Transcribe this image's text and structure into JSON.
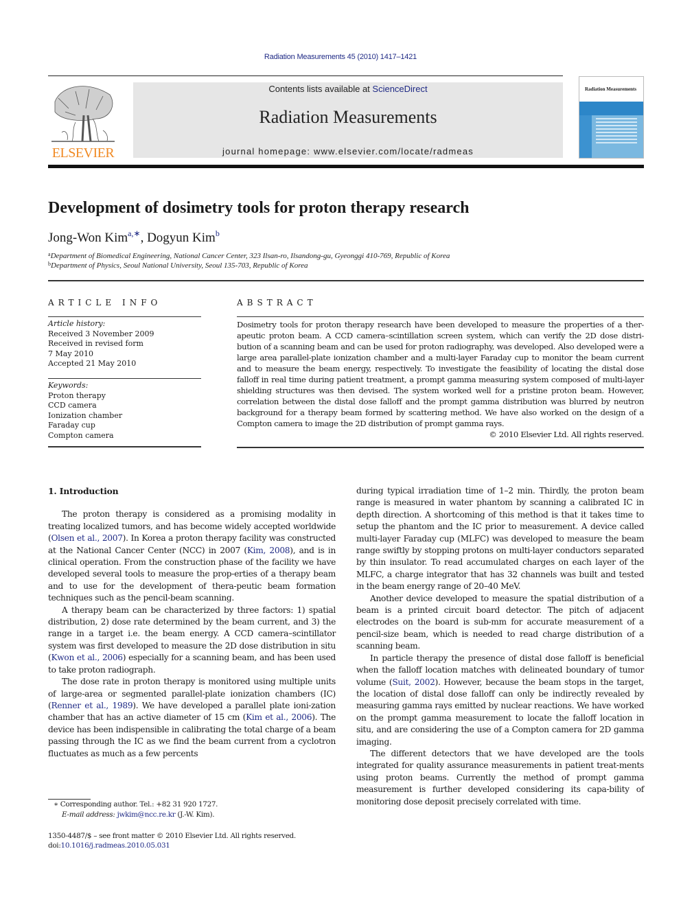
{
  "header": {
    "citation": "Radiation Measurements 45 (2010) 1417–1421",
    "contents_prefix": "Contents lists available at ",
    "contents_link": "ScienceDirect",
    "journal_name": "Radiation Measurements",
    "homepage_prefix": "journal homepage: ",
    "homepage_url": "www.elsevier.com/locate/radmeas",
    "publisher_logo_text": "ELSEVIER",
    "cover_title": "Radiation Measurements"
  },
  "colors": {
    "link": "#1f2a85",
    "elsevier_orange": "#f08a24",
    "banner_gray": "#e6e6e6",
    "cover_blue": "#7ab8e0"
  },
  "article": {
    "title": "Development of dosimetry tools for proton therapy research",
    "authors": [
      {
        "name": "Jong-Won Kim",
        "marks": "a,∗"
      },
      {
        "name": "Dogyun Kim",
        "marks": "b"
      }
    ],
    "author_separator": ", ",
    "affiliations": [
      {
        "mark": "a",
        "text": "Department of Biomedical Engineering, National Cancer Center, 323 Ilsan-ro, Ilsandong-gu, Gyeonggi 410-769, Republic of Korea"
      },
      {
        "mark": "b",
        "text": "Department of Physics, Seoul National University, Seoul 135-703, Republic of Korea"
      }
    ]
  },
  "article_info": {
    "heading": "ARTICLE INFO",
    "history_label": "Article history:",
    "history": [
      "Received 3 November 2009",
      "Received in revised form",
      "7 May 2010",
      "Accepted 21 May 2010"
    ],
    "keywords_label": "Keywords:",
    "keywords": [
      "Proton therapy",
      "CCD camera",
      "Ionization chamber",
      "Faraday cup",
      "Compton camera"
    ]
  },
  "abstract": {
    "heading": "ABSTRACT",
    "text": "Dosimetry tools for proton therapy research have been developed to measure the properties of a ther-apeutic proton beam. A CCD camera–scintillation screen system, which can verify the 2D dose distri-bution of a scanning beam and can be used for proton radiography, was developed. Also developed were a large area parallel-plate ionization chamber and a multi-layer Faraday cup to monitor the beam current and to measure the beam energy, respectively. To investigate the feasibility of locating the distal dose falloff in real time during patient treatment, a prompt gamma measuring system composed of multi-layer shielding structures was then devised. The system worked well for a pristine proton beam. However, correlation between the distal dose falloff and the prompt gamma distribution was blurred by neutron background for a therapy beam formed by scattering method. We have also worked on the design of a Compton camera to image the 2D distribution of prompt gamma rays.",
    "copyright": "© 2010 Elsevier Ltd. All rights reserved."
  },
  "body": {
    "section_heading": "1.  Introduction",
    "left_paragraphs": [
      [
        {
          "t": "The proton therapy is considered as a promising modality in treating localized tumors, and has become widely accepted worldwide ("
        },
        {
          "t": "Olsen et al., 2007",
          "link": true
        },
        {
          "t": "). In Korea a proton therapy facility was constructed at the National Cancer Center (NCC) in 2007 ("
        },
        {
          "t": "Kim, 2008",
          "link": true
        },
        {
          "t": "), and is in clinical operation. From the construction phase of the facility we have developed several tools to measure the prop-erties of a therapy beam and to use for the development of thera-peutic beam formation techniques such as the pencil-beam scanning."
        }
      ],
      [
        {
          "t": "A therapy beam can be characterized by three factors: 1) spatial distribution, 2) dose rate determined by the beam current, and 3) the range in a target i.e. the beam energy. A CCD camera–scintillator system was first developed to measure the 2D dose distribution in situ ("
        },
        {
          "t": "Kwon et al., 2006",
          "link": true
        },
        {
          "t": ") especially for a scanning beam, and has been used to take proton radiograph."
        }
      ],
      [
        {
          "t": "The dose rate in proton therapy is monitored using multiple units of large-area or segmented parallel-plate ionization chambers (IC) ("
        },
        {
          "t": "Renner et al., 1989",
          "link": true
        },
        {
          "t": "). We have developed a parallel plate ioni-zation chamber that has an active diameter of 15 cm ("
        },
        {
          "t": "Kim et al., 2006",
          "link": true
        },
        {
          "t": "). The device has been indispensible in calibrating the total charge of a beam passing through the IC as we find the beam current from a cyclotron fluctuates as much as a few percents"
        }
      ]
    ],
    "right_paragraphs": [
      [
        {
          "t": "during typical irradiation time of 1–2 min. Thirdly, the proton beam range is measured in water phantom by scanning a calibrated IC in depth direction. A shortcoming of this method is that it takes time to setup the phantom and the IC prior to measurement. A device called multi-layer Faraday cup (MLFC) was developed to measure the beam range swiftly by stopping protons on multi-layer conductors separated by thin insulator. To read accumulated charges on each layer of the MLFC, a charge integrator that has 32 channels was built and tested in the beam energy range of 20–40 MeV."
        }
      ],
      [
        {
          "t": "Another device developed to measure the spatial distribution of a beam is a printed circuit board detector. The pitch of adjacent electrodes on the board is sub-mm for accurate measurement of a pencil-size beam, which is needed to read charge distribution of a scanning beam."
        }
      ],
      [
        {
          "t": "In particle therapy the presence of distal dose falloff is beneficial when the falloff location matches with delineated boundary of tumor volume ("
        },
        {
          "t": "Suit, 2002",
          "link": true
        },
        {
          "t": "). However, because the beam stops in the target, the location of distal dose falloff can only be indirectly revealed by measuring gamma rays emitted by nuclear reactions. We have worked on the prompt gamma measurement to locate the falloff location in situ, and are considering the use of a Compton camera for 2D gamma imaging."
        }
      ],
      [
        {
          "t": "The different detectors that we have developed are the tools integrated for quality assurance measurements in patient treat-ments using proton beams. Currently the method of prompt gamma measurement is further developed considering its capa-bility of monitoring dose deposit precisely correlated with time."
        }
      ]
    ]
  },
  "footnotes": {
    "corresponding_mark": "∗",
    "corresponding_text": " Corresponding author. Tel.: +82 31 920 1727.",
    "email_label": "E-mail address: ",
    "email": "jwkim@ncc.re.kr",
    "email_suffix": " (J.-W. Kim).",
    "front_matter": "1350-4487/$ – see front matter © 2010 Elsevier Ltd. All rights reserved.",
    "doi_label": "doi:",
    "doi": "10.1016/j.radmeas.2010.05.031"
  }
}
